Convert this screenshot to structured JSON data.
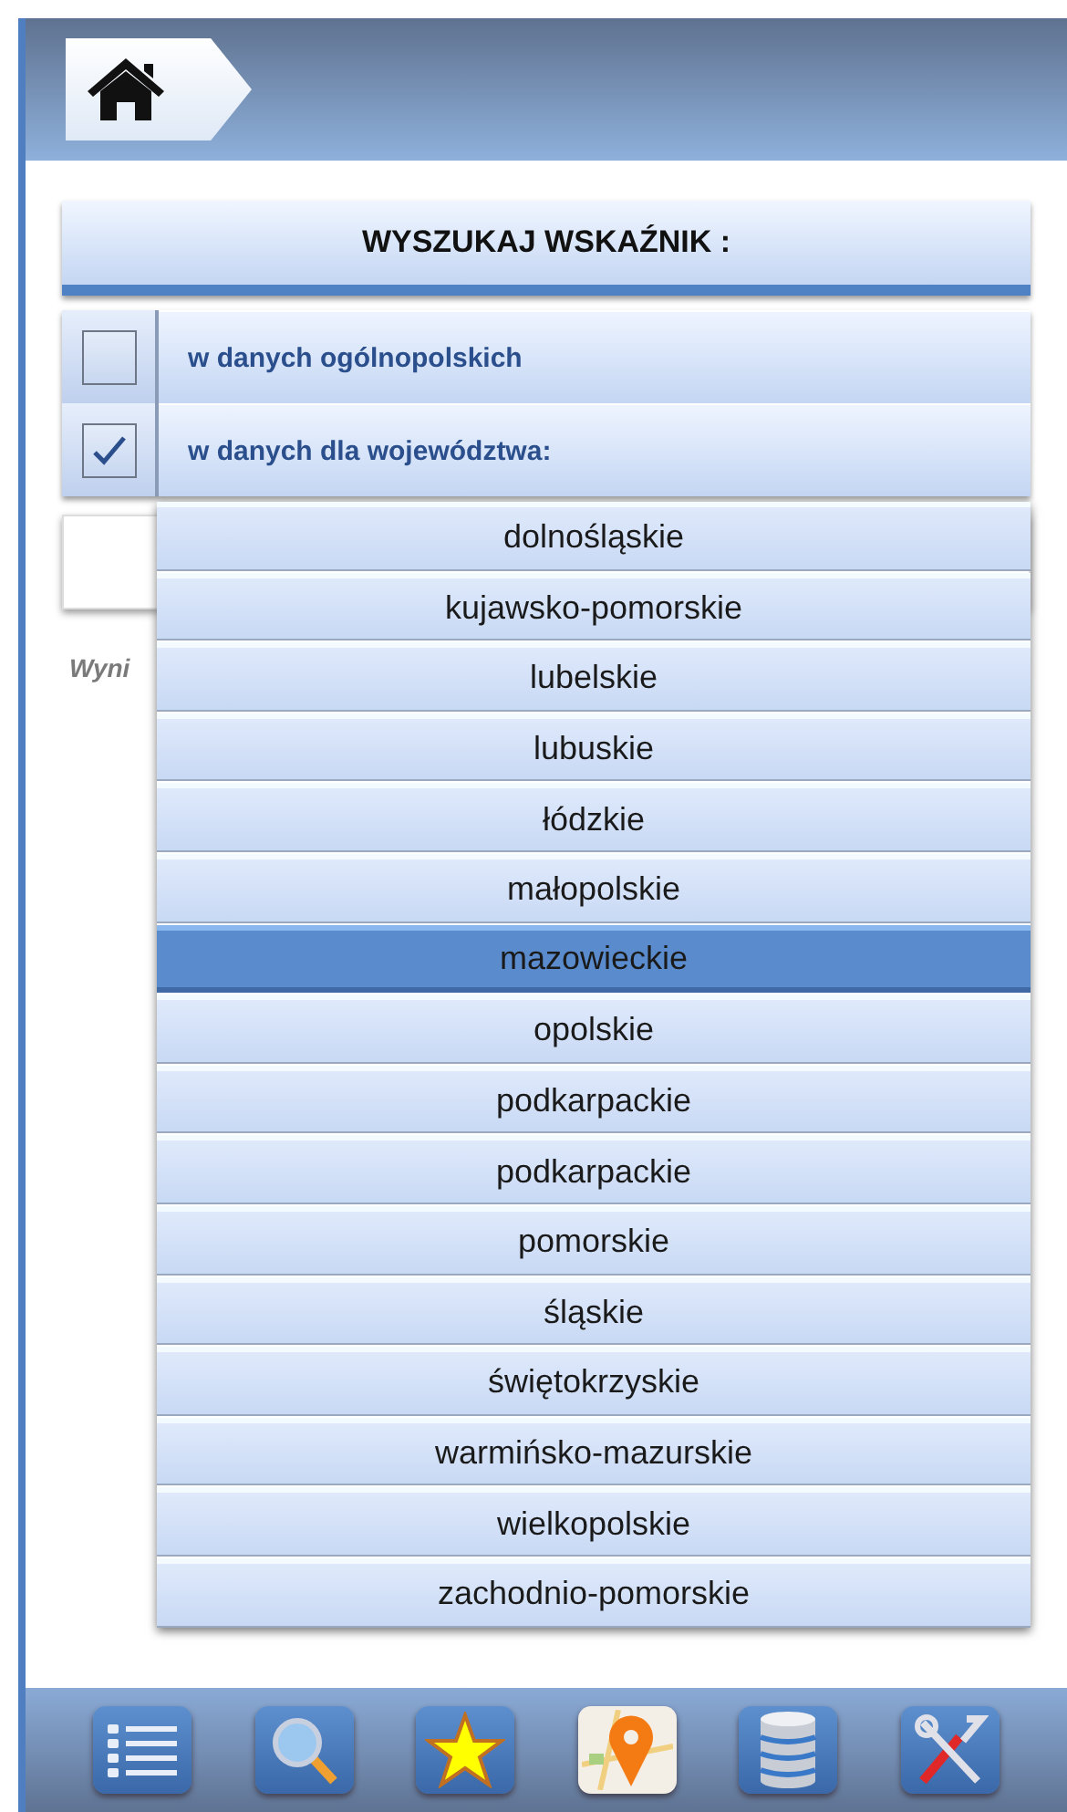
{
  "search_header": "WYSZUKAJ WSKAŹNIK :",
  "scope_options": [
    {
      "label": "w danych  ogólnopolskich",
      "checked": false
    },
    {
      "label": "w danych  dla województwa:",
      "checked": true
    }
  ],
  "results_label": "Wyni",
  "province_dropdown": [
    {
      "label": "dolnośląskie",
      "selected": false
    },
    {
      "label": "kujawsko-pomorskie",
      "selected": false
    },
    {
      "label": "lubelskie",
      "selected": false
    },
    {
      "label": "lubuskie",
      "selected": false
    },
    {
      "label": "łódzkie",
      "selected": false
    },
    {
      "label": "małopolskie",
      "selected": false
    },
    {
      "label": "mazowieckie",
      "selected": true
    },
    {
      "label": "opolskie",
      "selected": false
    },
    {
      "label": "podkarpackie",
      "selected": false
    },
    {
      "label": "podkarpackie",
      "selected": false
    },
    {
      "label": "pomorskie",
      "selected": false
    },
    {
      "label": "śląskie",
      "selected": false
    },
    {
      "label": "świętokrzyskie",
      "selected": false
    },
    {
      "label": "warmińsko-mazurskie",
      "selected": false
    },
    {
      "label": "wielkopolskie",
      "selected": false
    },
    {
      "label": "zachodnio-pomorskie",
      "selected": false
    }
  ]
}
